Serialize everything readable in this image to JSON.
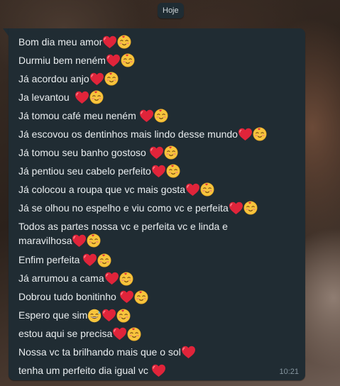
{
  "date_chip": "Hoje",
  "message": {
    "time": "10:21",
    "lines": [
      {
        "text": "Bom dia meu amor",
        "emojis": [
          "heart-icon",
          "smiling-face-with-hearts-icon"
        ]
      },
      {
        "text": "Durmiu bem neném",
        "emojis": [
          "heart-icon",
          "smiling-face-with-hearts-icon"
        ]
      },
      {
        "text": "Já acordou anjo",
        "emojis": [
          "heart-icon",
          "smiling-face-with-hearts-icon"
        ]
      },
      {
        "text": "Ja levantou  ",
        "emojis": [
          "heart-icon",
          "smiling-face-with-hearts-icon"
        ]
      },
      {
        "text": "Já tomou café meu neném ",
        "emojis": [
          "heart-icon",
          "smiling-face-with-hearts-icon"
        ]
      },
      {
        "text": "Já escovou os dentinhos mais lindo desse mundo",
        "emojis": [
          "heart-icon",
          "smiling-face-with-hearts-icon"
        ]
      },
      {
        "text": "Já tomou seu banho gostoso ",
        "emojis": [
          "heart-icon",
          "smiling-face-with-hearts-icon"
        ]
      },
      {
        "text": "Já pentiou seu cabelo perfeito",
        "emojis": [
          "heart-icon",
          "smiling-face-with-hearts-icon"
        ]
      },
      {
        "text": "Já colocou a roupa que vc mais gosta",
        "emojis": [
          "heart-icon",
          "smiling-face-with-hearts-icon"
        ]
      },
      {
        "text": "Já se olhou no espelho e viu como vc e perfeita",
        "emojis": [
          "heart-icon",
          "smiling-face-with-hearts-icon"
        ]
      },
      {
        "text": "Todos as partes nossa vc e perfeita vc e linda e",
        "emojis": []
      },
      {
        "text": "maravilhosa",
        "emojis": [
          "heart-icon",
          "smiling-face-with-hearts-icon"
        ]
      },
      {
        "text": "Enfim perfeita ",
        "emojis": [
          "heart-icon",
          "smiling-face-with-hearts-icon"
        ]
      },
      {
        "text": "Já arrumou a cama",
        "emojis": [
          "heart-icon",
          "smiling-face-with-hearts-icon"
        ]
      },
      {
        "text": "Dobrou tudo bonitinho ",
        "emojis": [
          "heart-icon",
          "smiling-face-with-hearts-icon"
        ]
      },
      {
        "text": "Espero que sim",
        "emojis": [
          "grinning-sweat-icon",
          "heart-icon",
          "smiling-face-with-hearts-icon"
        ]
      },
      {
        "text": "estou aqui se precisa",
        "emojis": [
          "heart-icon",
          "smiling-face-with-hearts-icon"
        ]
      },
      {
        "text": "Nossa vc ta brilhando mais que o sol",
        "emojis": [
          "heart-icon"
        ]
      },
      {
        "text": "tenha um perfeito dia igual vc ",
        "emojis": [
          "heart-icon"
        ]
      }
    ]
  }
}
